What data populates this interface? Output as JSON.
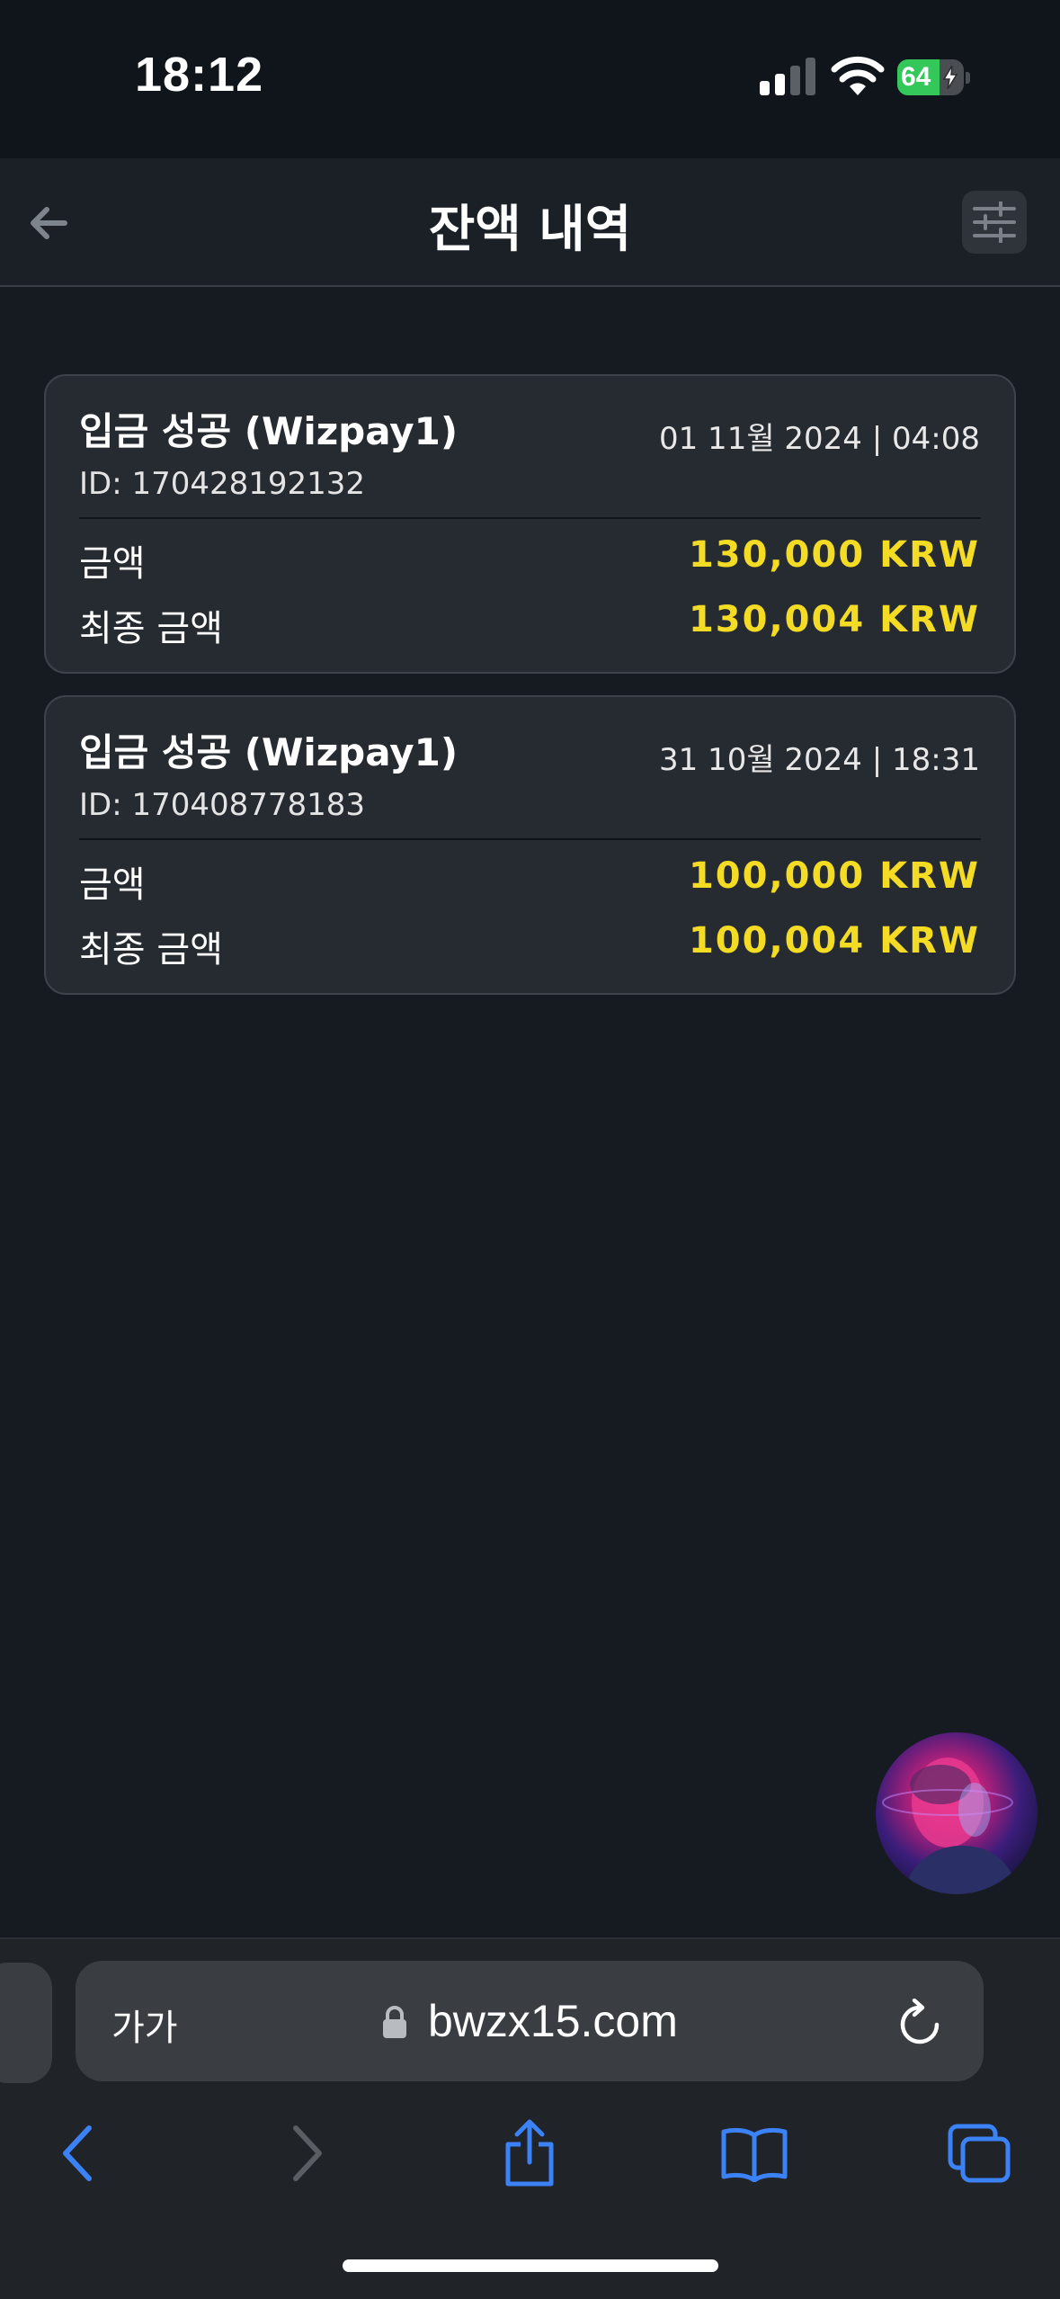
{
  "status_bar": {
    "time": "18:12",
    "battery_level": "64",
    "battery_fraction": 0.64,
    "charging": true
  },
  "header": {
    "title": "잔액 내역",
    "back_icon": "arrow-left-icon",
    "filter_icon": "sliders-icon"
  },
  "transactions": [
    {
      "title": "입금 성공 (Wizpay1)",
      "date": "01 11월 2024 | 04:08",
      "id": "ID: 170428192132",
      "amount_label": "금액",
      "amount_value": "130,000 KRW",
      "final_label": "최종 금액",
      "final_value": "130,004 KRW"
    },
    {
      "title": "입금 성공 (Wizpay1)",
      "date": "31 10월 2024 | 18:31",
      "id": "ID: 170408778183",
      "amount_label": "금액",
      "amount_value": "100,000 KRW",
      "final_label": "최종 금액",
      "final_value": "100,004 KRW"
    }
  ],
  "browser": {
    "text_size_label": "가가",
    "url": "bwzx15.com"
  },
  "colors": {
    "accent_amount": "#f5dc24",
    "background": "#161a21",
    "card": "#262a31",
    "ios_blue": "#3b82f6",
    "battery_green": "#34c759"
  }
}
